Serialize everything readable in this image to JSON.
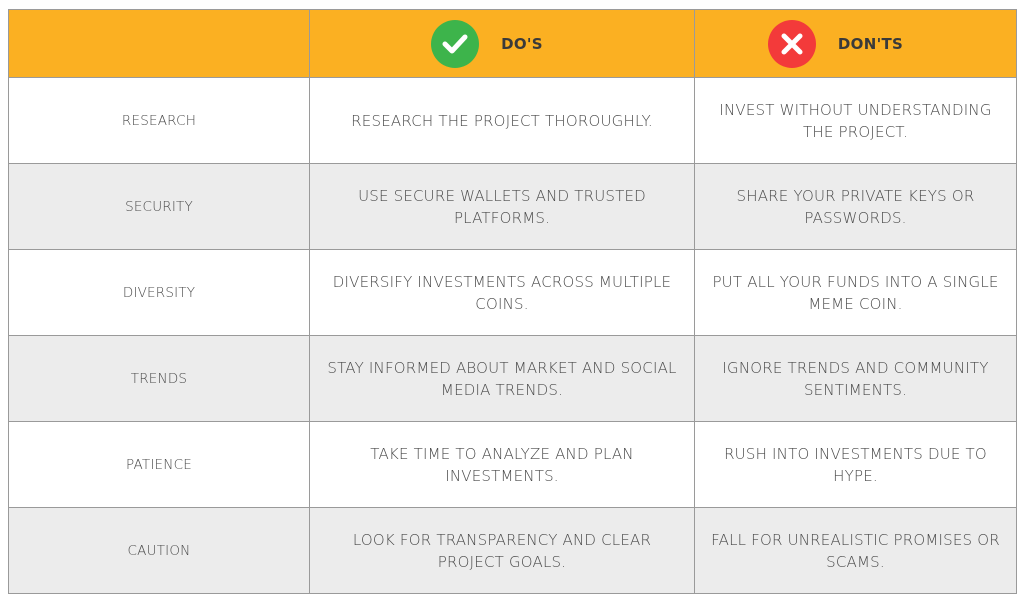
{
  "header": {
    "first_column_label": "",
    "dos_label": "DO'S",
    "donts_label": "DON'TS",
    "dos_icon": "check-circle-icon",
    "donts_icon": "x-circle-icon",
    "colors": {
      "header_bg": "#fbb022",
      "dos_icon": "#3db44b",
      "donts_icon": "#f33a3a",
      "alt_row_bg": "#ececec"
    }
  },
  "rows": [
    {
      "category": "RESEARCH",
      "do": "RESEARCH THE PROJECT THOROUGHLY.",
      "dont": "INVEST WITHOUT UNDERSTANDING THE PROJECT."
    },
    {
      "category": "SECURITY",
      "do": "USE SECURE WALLETS AND TRUSTED PLATFORMS.",
      "dont": "SHARE YOUR PRIVATE KEYS OR PASSWORDS."
    },
    {
      "category": "DIVERSITY",
      "do": "DIVERSIFY INVESTMENTS ACROSS MULTIPLE COINS.",
      "dont": "PUT ALL YOUR FUNDS INTO A SINGLE MEME COIN."
    },
    {
      "category": "TRENDS",
      "do": "STAY INFORMED ABOUT MARKET AND SOCIAL MEDIA TRENDS.",
      "dont": "IGNORE TRENDS AND COMMUNITY SENTIMENTS."
    },
    {
      "category": "PATIENCE",
      "do": "TAKE TIME TO ANALYZE AND PLAN INVESTMENTS.",
      "dont": "RUSH INTO INVESTMENTS DUE TO HYPE."
    },
    {
      "category": "CAUTION",
      "do": "LOOK FOR TRANSPARENCY AND CLEAR PROJECT GOALS.",
      "dont": "FALL FOR UNREALISTIC PROMISES OR SCAMS."
    }
  ]
}
